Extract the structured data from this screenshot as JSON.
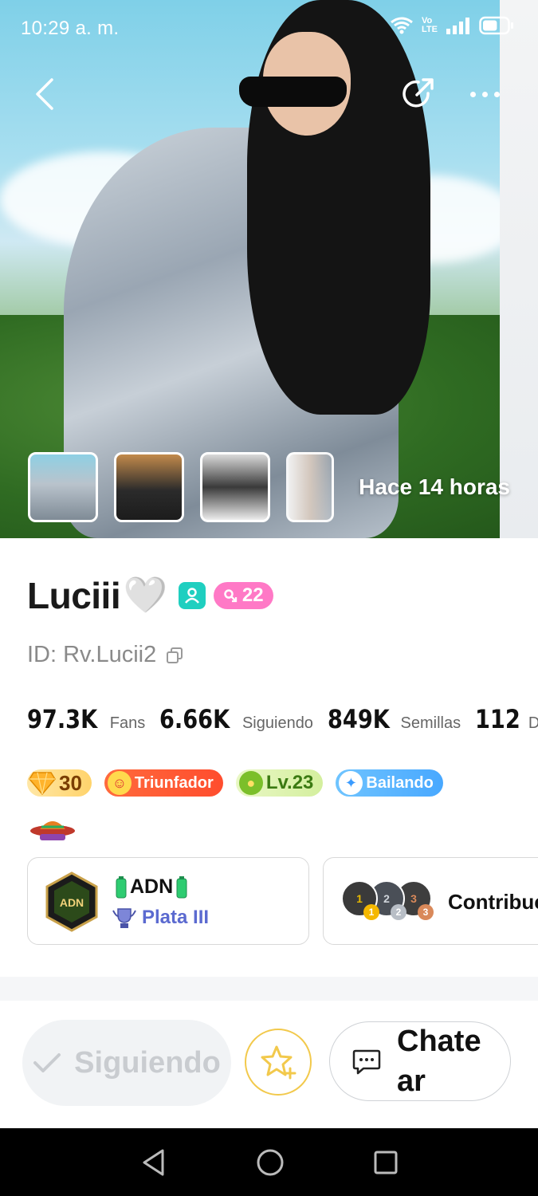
{
  "status_bar": {
    "time": "10:29 a. m.",
    "network_top": "Vo",
    "network_bottom": "LTE",
    "battery_level": 0.6
  },
  "hero": {
    "posted_ago": "Hace 14 horas",
    "thumbnails_count": 4
  },
  "profile": {
    "name": "Luciii",
    "name_emoji": "🤍",
    "age": "22",
    "id_text": "ID: Rv.Lucii2",
    "stats": [
      {
        "value": "97.3K",
        "label": "Fans"
      },
      {
        "value": "6.66K",
        "label": "Siguiendo"
      },
      {
        "value": "849K",
        "label": "Semillas"
      },
      {
        "value": "112",
        "label": "Dia"
      }
    ],
    "badges": {
      "diamond": "30",
      "title": "Triunfador",
      "level": "Lv.23",
      "activity": "Bailando"
    },
    "family": {
      "name": "ADN",
      "rank": "Plata III",
      "logo_text": "ADN"
    },
    "contributors": {
      "label": "Contribuc",
      "medals": [
        "1",
        "2",
        "3"
      ]
    }
  },
  "actions": {
    "follow_label": "Siguiendo",
    "chat_label": "Chatear"
  },
  "colors": {
    "accent_teal": "#1fcfc0",
    "accent_pink": "#ff79c6",
    "rank_blue": "#5b6ad0",
    "star_yellow": "#f2c94c"
  }
}
